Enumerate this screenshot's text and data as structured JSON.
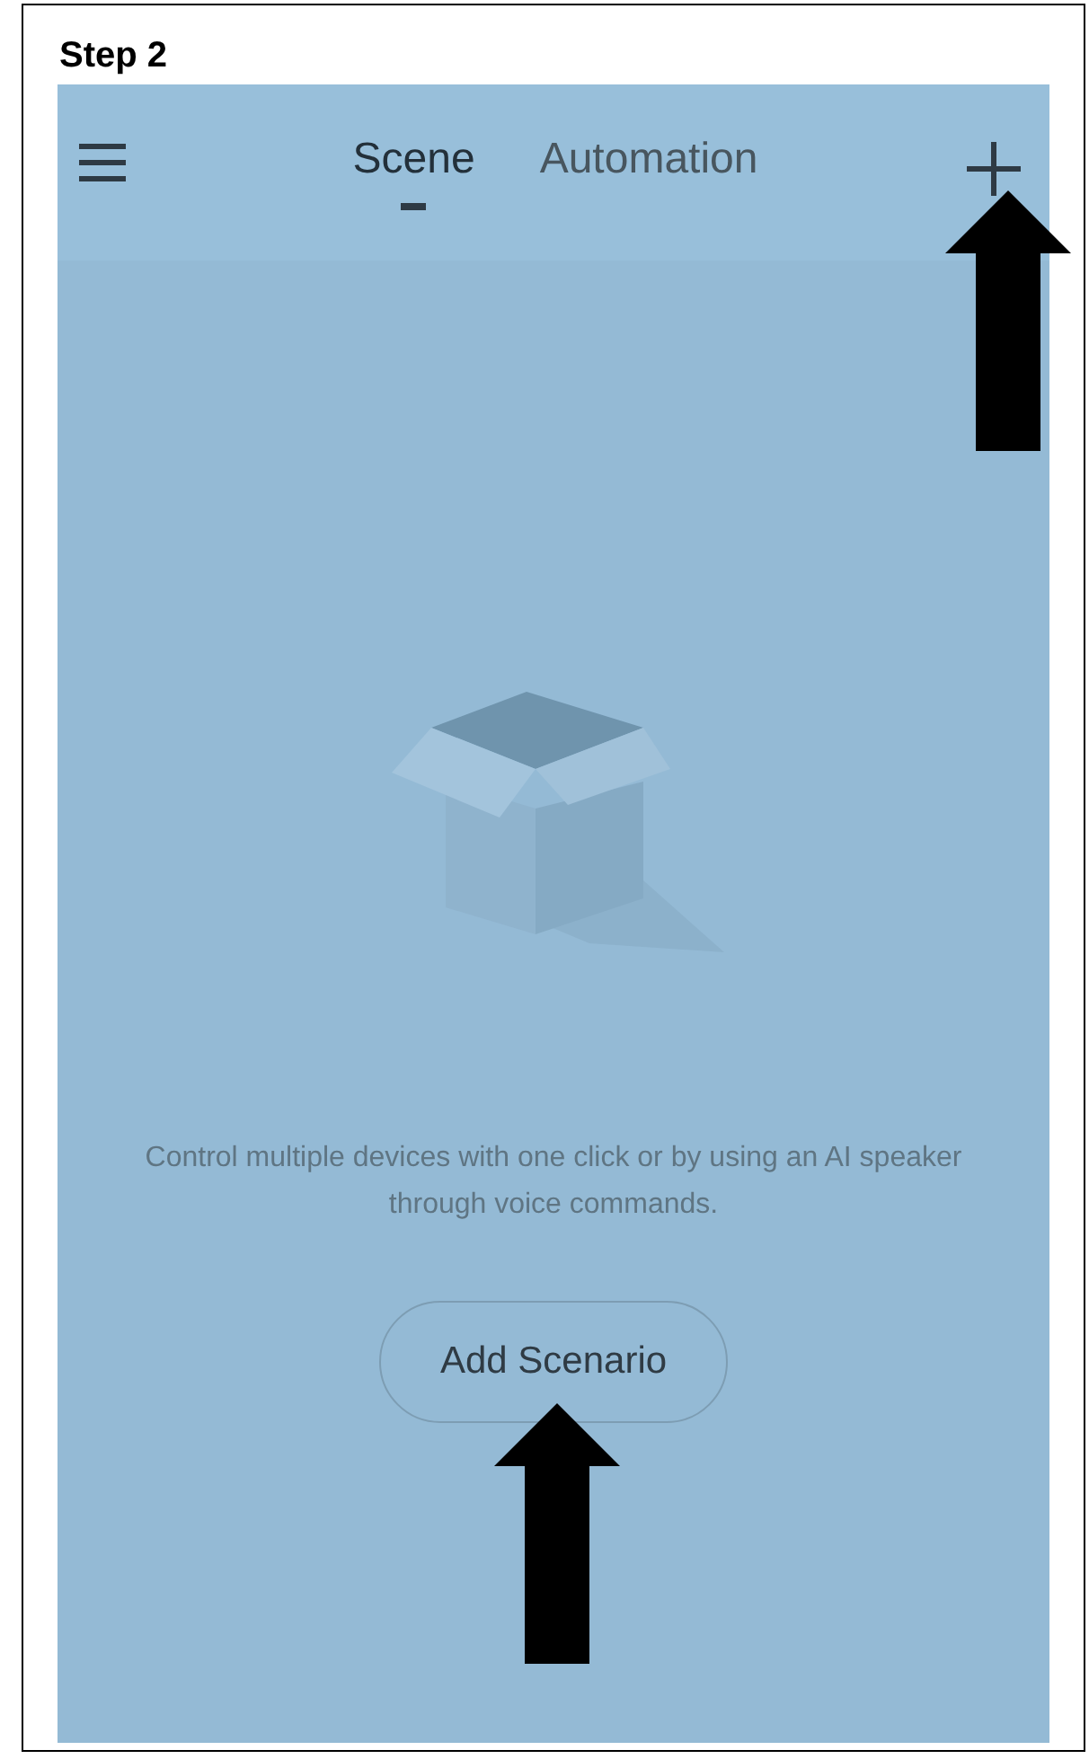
{
  "step_title": "Step 2",
  "tabs": [
    {
      "label": "Scene",
      "selected": true
    },
    {
      "label": "Automation",
      "selected": false
    }
  ],
  "empty_state": {
    "message": "Control multiple devices with one click or by using an AI speaker through voice commands.",
    "button": "Add Scenario"
  }
}
